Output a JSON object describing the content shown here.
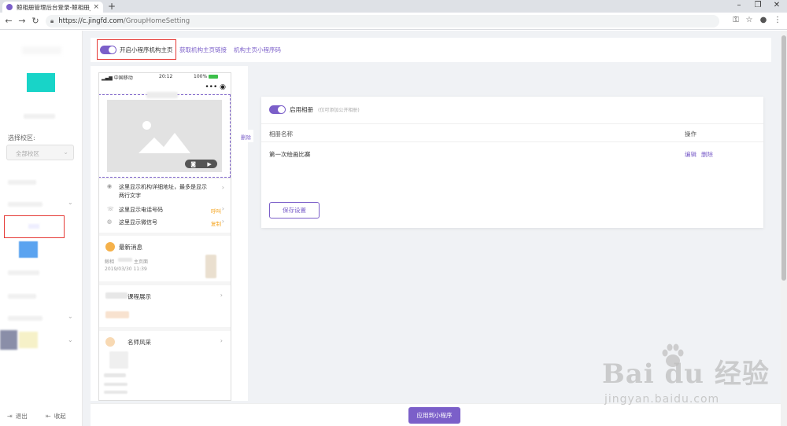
{
  "browser": {
    "tab_title": "鲸相册管理后台登录-鲸相册_企业...",
    "tab_close": "×",
    "new_tab": "+",
    "url_host": "https://c.jingfd.com",
    "url_path": "/GroupHomeSetting"
  },
  "sidebar": {
    "school_label": "选择校区:",
    "school_select_value": "全部校区",
    "footer_logout": "退出",
    "footer_collapse": "收起"
  },
  "topbar": {
    "toggle_label": "开启小程序机构主页",
    "toggle_on": true,
    "link_get_url": "获取机构主页链接",
    "link_qrcode": "机构主页小程序码"
  },
  "phone": {
    "status_carrier": "中国移动",
    "status_time": "20:12",
    "status_battery": "100%",
    "delete_label": "删除",
    "address_text": "这里显示机构详细地址，最多是显示两行文字",
    "phone_text": "这里显示电话号码",
    "phone_action": "呼叫",
    "wechat_text": "这里显示微信号",
    "wechat_action": "复制",
    "news_title": "最新消息",
    "news_item_text": "鲸相",
    "news_item_text2": "主页面",
    "news_date": "2019/03/30 11:39",
    "course_title": "课程展示",
    "teacher_title": "名师风采"
  },
  "album": {
    "toggle_label": "启用相册",
    "toggle_on": true,
    "hint": "(仅可添加公开相册)",
    "col_name": "相册名称",
    "col_action": "操作",
    "rows": [
      {
        "name": "第一次绘画比赛",
        "edit": "编辑",
        "delete": "删除"
      }
    ],
    "save_label": "保存设置"
  },
  "bottom": {
    "apply_label": "应用到小程序"
  },
  "watermark": {
    "brand": "Bai du 经验",
    "url": "jingyan.baidu.com"
  },
  "colors": {
    "accent": "#7b5fc9",
    "highlight_border": "#e53935",
    "warning": "#f5a623"
  }
}
